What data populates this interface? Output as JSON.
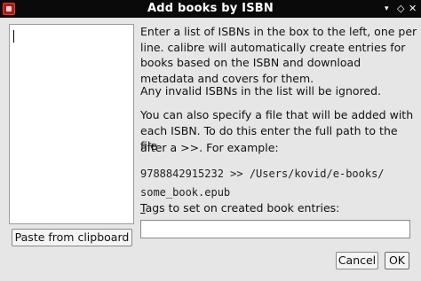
{
  "window": {
    "title": "Add books by ISBN",
    "controls": {
      "menu": "▾",
      "maximize": "◇",
      "close": "✕"
    }
  },
  "left": {
    "isbn_box_value": "",
    "paste_label": "Paste from clipboard"
  },
  "instructions": {
    "p1": "Enter a list of ISBNs in the box to the left, one per line. calibre will automatically create entries for books based on the ISBN and download metadata and covers for them.",
    "p2": "Any invalid ISBNs in the list will be ignored.",
    "p3": "You can also specify a file that will be added with each ISBN. To do this enter the full path to the file",
    "p4": "after a >>. For example:",
    "example_line1": "9788842915232 >> /Users/kovid/e-books/",
    "example_line2": "some_book.epub"
  },
  "tags": {
    "label_mnemonic": "T",
    "label_rest": "ags to set on created book entries:",
    "value": ""
  },
  "buttons": {
    "cancel": "Cancel",
    "ok": "OK"
  }
}
